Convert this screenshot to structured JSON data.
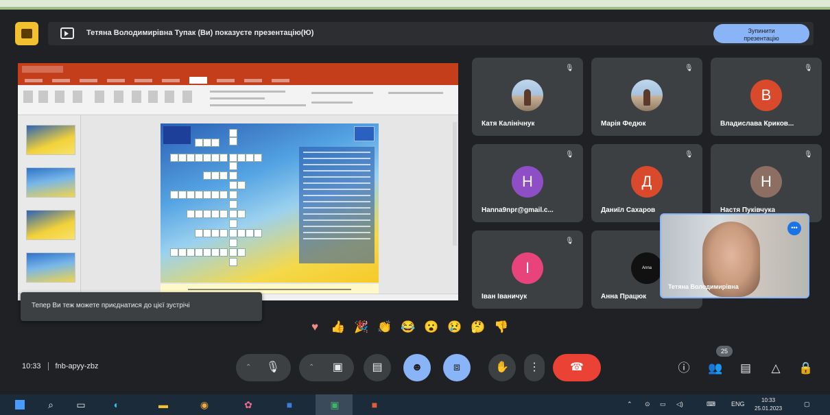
{
  "presenting": {
    "text": "Тетяна Володимирівна Тупак (Ви) показуєте презентацію(Ю)",
    "stop_label_line1": "Зупинити",
    "stop_label_line2": "презентацію"
  },
  "notification": "Тепер Ви теж можете приєднатися до цієї зустрічі",
  "participants": [
    {
      "name": "Катя Калінічнук",
      "initial": "",
      "color": "photo"
    },
    {
      "name": "Марія Федюк",
      "initial": "",
      "color": "photo"
    },
    {
      "name": "Владислава Криков...",
      "initial": "В",
      "color": "#d84a2b"
    },
    {
      "name": "Hanna9npr@gmail.c...",
      "initial": "Н",
      "color": "#8e4fc6"
    },
    {
      "name": "Даниїл Сахаров",
      "initial": "Д",
      "color": "#d84a2b"
    },
    {
      "name": "Настя Пуківчука",
      "initial": "Н",
      "color": "#8d6e63"
    },
    {
      "name": "Іван Іваничук",
      "initial": "І",
      "color": "#e8437a"
    },
    {
      "name": "Анна Працюк",
      "initial": "Anna",
      "color": "#111111"
    }
  ],
  "selfview": {
    "name": "Тетяна Володимирівна",
    "more_icon": "more-icon"
  },
  "reactions": [
    "heart",
    "thumbs-up",
    "party",
    "clap",
    "laugh",
    "surprised",
    "sad",
    "thinking",
    "thumbs-down"
  ],
  "meeting": {
    "time": "10:33",
    "code": "fnb-apyy-zbz"
  },
  "controls": {
    "people_count": "25"
  },
  "taskbar": {
    "language": "ENG",
    "clock_time": "10:33",
    "clock_date": "25.01.2023"
  },
  "colors": {
    "background": "#202124",
    "accent_blue": "#8ab4f8",
    "end_call_red": "#ea4335",
    "meet_yellow": "#f3c12f"
  }
}
